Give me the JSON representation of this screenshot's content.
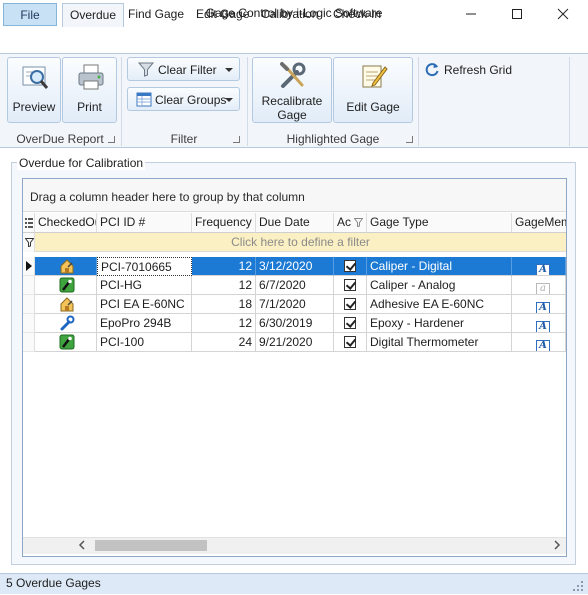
{
  "window": {
    "title": "Gage Control by i-Logic Software",
    "controls": [
      "minimize-icon",
      "maximize-icon",
      "close-icon"
    ]
  },
  "quick_access": [
    "app-icon",
    "barcode-icon"
  ],
  "ribbon": {
    "tabs": [
      {
        "label": "File"
      },
      {
        "label": "Overdue",
        "active": true
      },
      {
        "label": "Find Gage"
      },
      {
        "label": "Edit Gage"
      },
      {
        "label": "Calibration"
      },
      {
        "label": "Check-In"
      }
    ],
    "groups": {
      "overdue_report": {
        "label": "OverDue Report",
        "buttons": [
          {
            "label": "Preview",
            "icon": "preview-magnifier-icon"
          },
          {
            "label": "Print",
            "icon": "printer-icon"
          }
        ]
      },
      "filter": {
        "label": "Filter",
        "buttons": [
          {
            "label": "Clear Filter",
            "icon": "funnel-icon"
          },
          {
            "label": "Clear Groups",
            "icon": "grid-groups-icon"
          }
        ]
      },
      "highlighted_gage": {
        "label": "Highlighted Gage",
        "buttons": [
          {
            "label_line1": "Recalibrate",
            "label_line2": "Gage",
            "icon": "tools-icon"
          },
          {
            "label": "Edit Gage",
            "icon": "notepad-pencil-icon"
          }
        ]
      },
      "refresh": {
        "label": "Refresh Grid",
        "icon": "refresh-icon"
      }
    }
  },
  "panel": {
    "legend": "Overdue for Calibration",
    "group_hint": "Drag a column header here to group by that column",
    "filter_hint": "Click here to define a filter"
  },
  "grid": {
    "columns": [
      "CheckedOut",
      "PCI ID #",
      "Frequency",
      "Due Date",
      "Ac",
      "Gage Type",
      "GageMemo"
    ],
    "rows": [
      {
        "status_icon": "house-icon",
        "pci_id": "PCI-7010665",
        "frequency": "12",
        "due_date": "3/12/2020",
        "active": true,
        "gage_type": "Caliper - Digital",
        "memo": "A",
        "selected": true
      },
      {
        "status_icon": "check-in-icon",
        "pci_id": "PCI-HG",
        "frequency": "12",
        "due_date": "6/7/2020",
        "active": true,
        "gage_type": "Caliper - Analog",
        "memo": "a"
      },
      {
        "status_icon": "house-icon",
        "pci_id": "PCI EA E-60NC",
        "frequency": "18",
        "due_date": "7/1/2020",
        "active": true,
        "gage_type": "Adhesive EA E-60NC",
        "memo": "A"
      },
      {
        "status_icon": "wrench-icon",
        "pci_id": "EpoPro 294B",
        "frequency": "12",
        "due_date": "6/30/2019",
        "active": true,
        "gage_type": "Epoxy - Hardener",
        "memo": "A"
      },
      {
        "status_icon": "check-in-icon",
        "pci_id": "PCI-100",
        "frequency": "24",
        "due_date": "9/21/2020",
        "active": true,
        "gage_type": "Digital Thermometer",
        "memo": "A"
      }
    ]
  },
  "status": {
    "text": "5 Overdue Gages"
  },
  "colors": {
    "selection": "#1c7ad4",
    "filter_row": "#fbf0c3",
    "ribbon_bg": "#f2f6fb",
    "status_bg": "#dde9f6"
  }
}
